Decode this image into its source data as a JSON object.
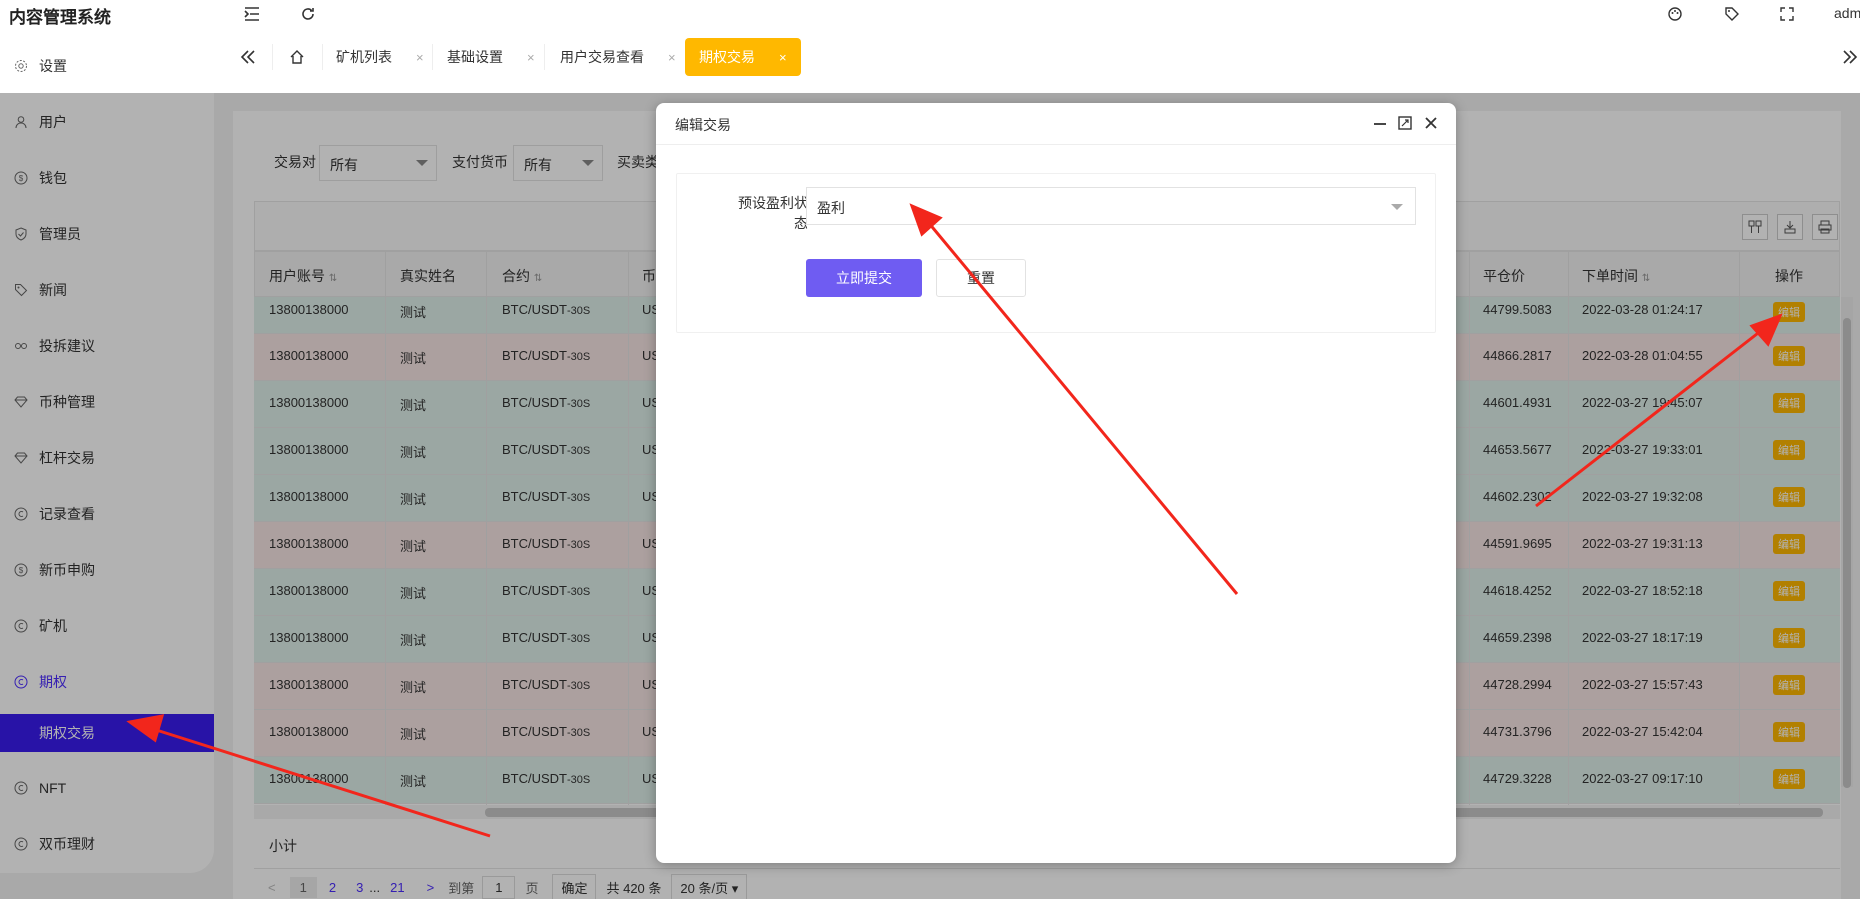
{
  "app": {
    "title": "内容管理系统",
    "user": "adm"
  },
  "tabs": [
    {
      "label": "矿机列表"
    },
    {
      "label": "基础设置"
    },
    {
      "label": "用户交易查看"
    },
    {
      "label": "期权交易",
      "active": true
    }
  ],
  "tab_close": "×",
  "sidebar": {
    "items": [
      {
        "label": "设置",
        "icon": "gear-icon"
      },
      {
        "label": "用户",
        "icon": "user-icon"
      },
      {
        "label": "钱包",
        "icon": "dollar-icon"
      },
      {
        "label": "管理员",
        "icon": "shield-icon"
      },
      {
        "label": "新闻",
        "icon": "tag-icon"
      },
      {
        "label": "投拆建议",
        "icon": "link-icon"
      },
      {
        "label": "币种管理",
        "icon": "diamond-icon"
      },
      {
        "label": "杠杆交易",
        "icon": "diamond-icon"
      },
      {
        "label": "记录查看",
        "icon": "circle-c-icon"
      },
      {
        "label": "新币申购",
        "icon": "dollar-icon"
      },
      {
        "label": "矿机",
        "icon": "circle-c-icon"
      },
      {
        "label": "期权",
        "icon": "circle-c-icon",
        "open": true
      },
      {
        "label": "期权交易",
        "active": true
      },
      {
        "label": "NFT",
        "icon": "circle-c-icon"
      },
      {
        "label": "双币理财",
        "icon": "circle-c-icon"
      }
    ]
  },
  "filters": {
    "pair_label": "交易对",
    "pair_value": "所有",
    "currency_label": "支付货币",
    "currency_value": "所有",
    "direction_label": "买卖类"
  },
  "table": {
    "headers": [
      "用户账号",
      "真实姓名",
      "合约",
      "币",
      "平仓价",
      "下单时间",
      "操作"
    ],
    "edit_label": "编辑",
    "rows": [
      {
        "account": "13800138000",
        "name": "测试",
        "contract": "BTC/USDT",
        "period": "-30S",
        "coin": "US",
        "close_price": "44799.5083",
        "time": "2022-03-28 01:24:17",
        "tone": "green"
      },
      {
        "account": "13800138000",
        "name": "测试",
        "contract": "BTC/USDT",
        "period": "-30S",
        "coin": "US",
        "close_price": "44866.2817",
        "time": "2022-03-28 01:04:55",
        "tone": "red"
      },
      {
        "account": "13800138000",
        "name": "测试",
        "contract": "BTC/USDT",
        "period": "-30S",
        "coin": "US",
        "close_price": "44601.4931",
        "time": "2022-03-27 19:45:07",
        "tone": "green"
      },
      {
        "account": "13800138000",
        "name": "测试",
        "contract": "BTC/USDT",
        "period": "-30S",
        "coin": "US",
        "close_price": "44653.5677",
        "time": "2022-03-27 19:33:01",
        "tone": "green"
      },
      {
        "account": "13800138000",
        "name": "测试",
        "contract": "BTC/USDT",
        "period": "-30S",
        "coin": "US",
        "close_price": "44602.2302",
        "time": "2022-03-27 19:32:08",
        "tone": "green"
      },
      {
        "account": "13800138000",
        "name": "测试",
        "contract": "BTC/USDT",
        "period": "-30S",
        "coin": "US",
        "close_price": "44591.9695",
        "time": "2022-03-27 19:31:13",
        "tone": "red"
      },
      {
        "account": "13800138000",
        "name": "测试",
        "contract": "BTC/USDT",
        "period": "-30S",
        "coin": "US",
        "close_price": "44618.4252",
        "time": "2022-03-27 18:52:18",
        "tone": "green"
      },
      {
        "account": "13800138000",
        "name": "测试",
        "contract": "BTC/USDT",
        "period": "-30S",
        "coin": "US",
        "close_price": "44659.2398",
        "time": "2022-03-27 18:17:19",
        "tone": "green"
      },
      {
        "account": "13800138000",
        "name": "测试",
        "contract": "BTC/USDT",
        "period": "-30S",
        "coin": "US",
        "close_price": "44728.2994",
        "time": "2022-03-27 15:57:43",
        "tone": "red"
      },
      {
        "account": "13800138000",
        "name": "测试",
        "contract": "BTC/USDT",
        "period": "-30S",
        "coin": "US",
        "close_price": "44731.3796",
        "time": "2022-03-27 15:42:04",
        "tone": "red"
      },
      {
        "account": "13800138000",
        "name": "测试",
        "contract": "BTC/USDT",
        "period": "-30S",
        "coin": "US",
        "close_price": "44729.3228",
        "time": "2022-03-27 09:17:10",
        "tone": "green"
      }
    ],
    "subtotal_label": "小计"
  },
  "pager": {
    "pages": [
      "1",
      "2",
      "3",
      "...",
      "21"
    ],
    "goto_label": "到第",
    "goto_value": "1",
    "page_unit": "页",
    "confirm_label": "确定",
    "total": "共 420 条",
    "page_size": "20 条/页"
  },
  "dialog": {
    "title": "编辑交易",
    "field_label_1": "预设盈利状",
    "field_label_2": "态",
    "field_value": "盈利",
    "submit_label": "立即提交",
    "reset_label": "重置"
  },
  "colors": {
    "accent": "#ffb800",
    "sidebar_active": "#3a1cf0",
    "submit": "#6f5cf2",
    "arrow": "#f2261c"
  }
}
